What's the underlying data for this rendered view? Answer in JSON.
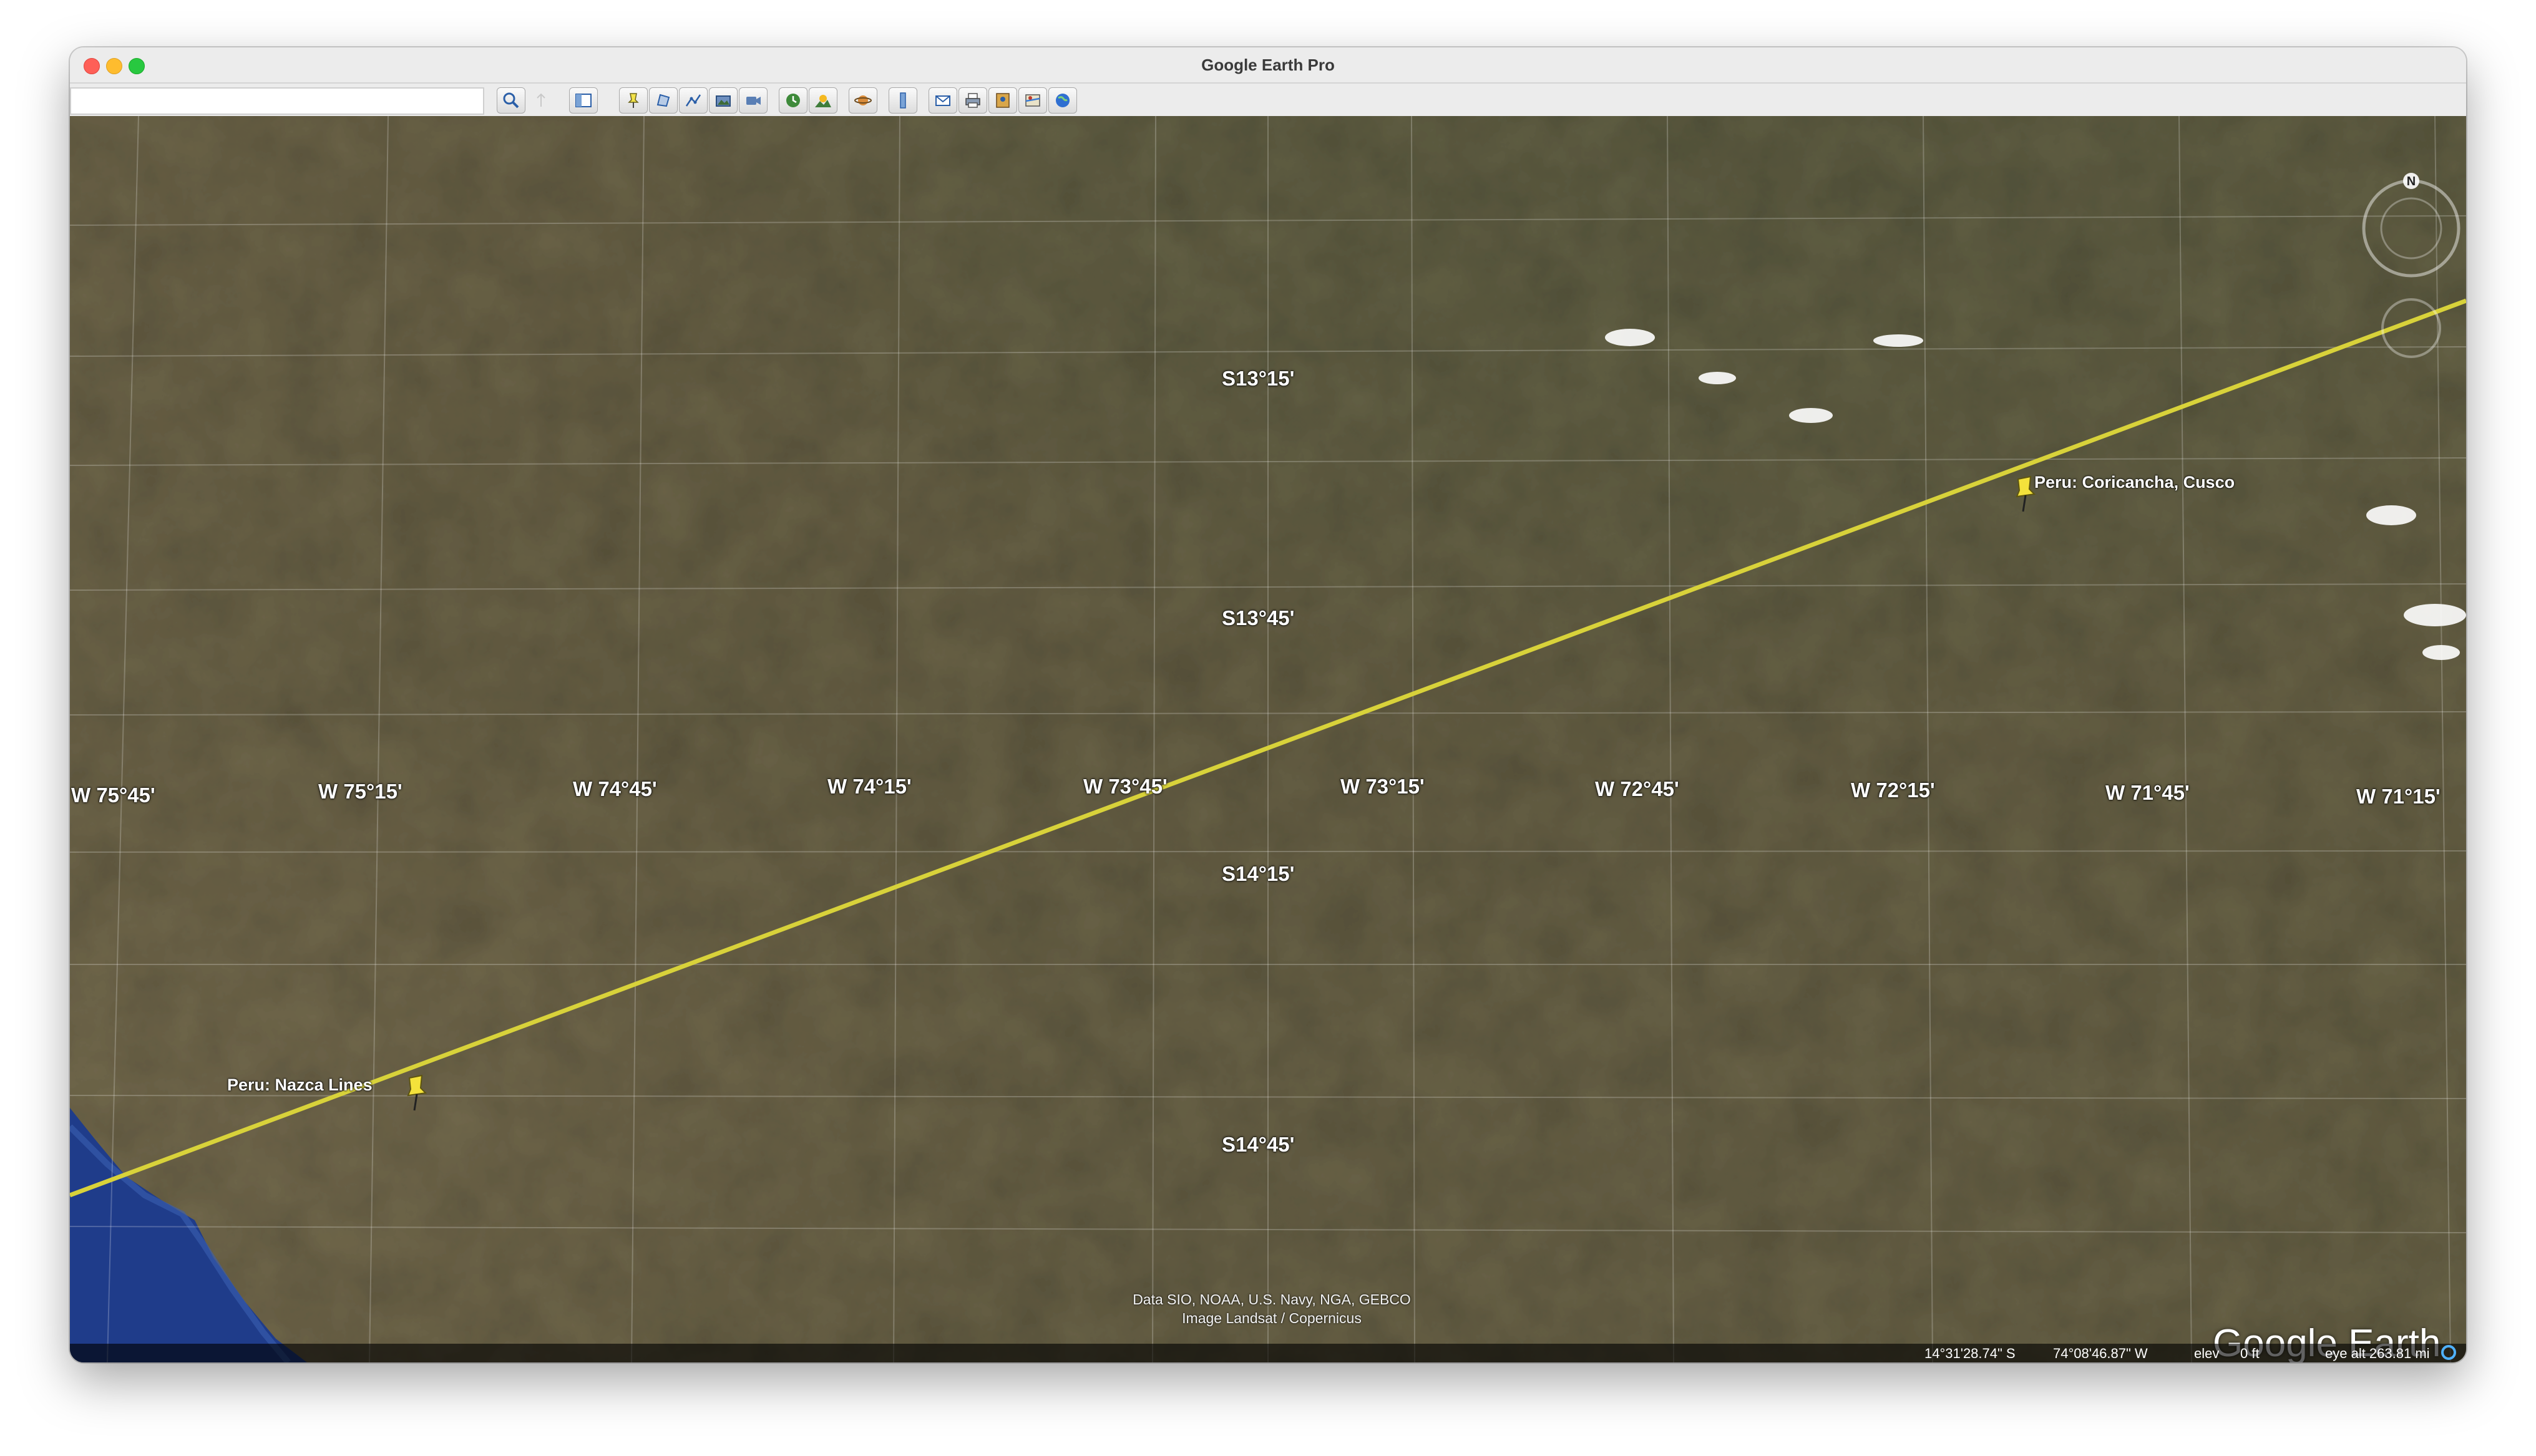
{
  "window": {
    "title": "Google Earth Pro"
  },
  "toolbar": {
    "search_value": "",
    "buttons": [
      {
        "name": "search-icon"
      },
      {
        "name": "sidebar-toggle-icon"
      },
      {
        "name": "sidebar-icon"
      },
      {
        "name": "add-placemark-icon"
      },
      {
        "name": "add-polygon-icon"
      },
      {
        "name": "add-path-icon"
      },
      {
        "name": "add-image-overlay-icon"
      },
      {
        "name": "record-tour-icon"
      },
      {
        "name": "historical-imagery-icon"
      },
      {
        "name": "sunlight-icon"
      },
      {
        "name": "switch-planet-icon"
      },
      {
        "name": "ruler-icon"
      },
      {
        "name": "email-icon"
      },
      {
        "name": "print-icon"
      },
      {
        "name": "save-image-icon"
      },
      {
        "name": "view-in-maps-icon"
      },
      {
        "name": "sign-in-earth-icon"
      }
    ]
  },
  "map": {
    "latitude_labels": [
      "S13°15'",
      "S13°45'",
      "S14°15'",
      "S14°45'"
    ],
    "longitude_labels": [
      "W 75°45'",
      "W 75°15'",
      "W 74°45'",
      "W 74°15'",
      "W 73°45'",
      "W 73°15'",
      "W 72°45'",
      "W 72°15'",
      "W 71°45'",
      "W 71°15'"
    ],
    "placemarks": [
      {
        "label": "Peru: Nazca Lines"
      },
      {
        "label": "Peru: Coricancha, Cusco"
      }
    ],
    "path_color": "#d8d23a",
    "credits": [
      "Data SIO, NOAA, U.S. Navy, NGA, GEBCO",
      "Image Landsat / Copernicus"
    ],
    "brand": "Google Earth",
    "compass_letter": "N"
  },
  "status": {
    "latitude": "14°31'28.74\" S",
    "longitude": "74°08'46.87\" W",
    "elev_label": "elev",
    "elev_value": "0 ft",
    "eye_alt": "eye alt 263.81 mi"
  }
}
